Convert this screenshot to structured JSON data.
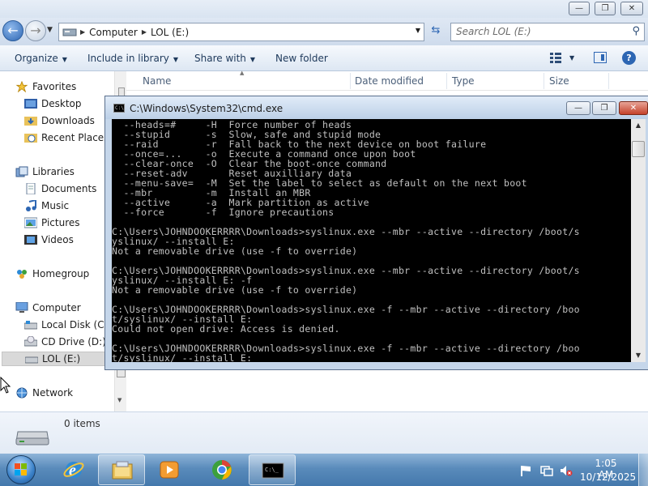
{
  "explorer": {
    "address": {
      "crumbs": [
        "Computer",
        "LOL (E:)"
      ]
    },
    "search": {
      "placeholder": "Search LOL (E:)"
    },
    "toolbar": {
      "organize": "Organize",
      "include_in_library": "Include in library",
      "share_with": "Share with",
      "new_folder": "New folder"
    },
    "nav": {
      "favorites": "Favorites",
      "desktop": "Desktop",
      "downloads": "Downloads",
      "recent_places": "Recent Places",
      "libraries": "Libraries",
      "documents": "Documents",
      "music": "Music",
      "pictures": "Pictures",
      "videos": "Videos",
      "homegroup": "Homegroup",
      "computer": "Computer",
      "local_disk": "Local Disk (C:)",
      "cd_drive": "CD Drive (D:) v",
      "lol_drive": "LOL (E:)",
      "network": "Network"
    },
    "columns": {
      "name": "Name",
      "date_modified": "Date modified",
      "type": "Type",
      "size": "Size"
    },
    "details": {
      "items_count": "0 items"
    }
  },
  "cmd": {
    "title": "C:\\Windows\\System32\\cmd.exe",
    "lines": [
      "  --heads=#     -H  Force number of heads",
      "  --stupid      -s  Slow, safe and stupid mode",
      "  --raid        -r  Fall back to the next device on boot failure",
      "  --once=...    -o  Execute a command once upon boot",
      "  --clear-once  -O  Clear the boot-once command",
      "  --reset-adv       Reset auxilliary data",
      "  --menu-save=  -M  Set the label to select as default on the next boot",
      "  --mbr         -m  Install an MBR",
      "  --active      -a  Mark partition as active",
      "  --force       -f  Ignore precautions",
      "",
      "C:\\Users\\JOHNDOOKERRRR\\Downloads>syslinux.exe --mbr --active --directory /boot/s",
      "yslinux/ --install E:",
      "Not a removable drive (use -f to override)",
      "",
      "C:\\Users\\JOHNDOOKERRRR\\Downloads>syslinux.exe --mbr --active --directory /boot/s",
      "yslinux/ --install E: -f",
      "Not a removable drive (use -f to override)",
      "",
      "C:\\Users\\JOHNDOOKERRRR\\Downloads>syslinux.exe -f --mbr --active --directory /boo",
      "t/syslinux/ --install E:",
      "Could not open drive: Access is denied.",
      "",
      "C:\\Users\\JOHNDOOKERRRR\\Downloads>syslinux.exe -f --mbr --active --directory /boo",
      "t/syslinux/ --install E:"
    ]
  },
  "taskbar": {
    "clock_time": "1:05 AM",
    "clock_date": "10/12/2025"
  },
  "colors": {
    "cmd_text": "#c0c0c0",
    "cmd_bg": "#000000",
    "taskbar": "#5a8bbb",
    "accent": "#2d66b3"
  },
  "icons": [
    "back-arrow-icon",
    "refresh-icon",
    "search-icon",
    "views-icon",
    "preview-pane-icon",
    "help-icon",
    "star-icon",
    "folder-icon",
    "library-icon",
    "homegroup-icon",
    "computer-icon",
    "drive-icon",
    "network-icon",
    "cmd-icon",
    "ie-icon",
    "explorer-icon",
    "media-player-icon",
    "chrome-icon"
  ]
}
